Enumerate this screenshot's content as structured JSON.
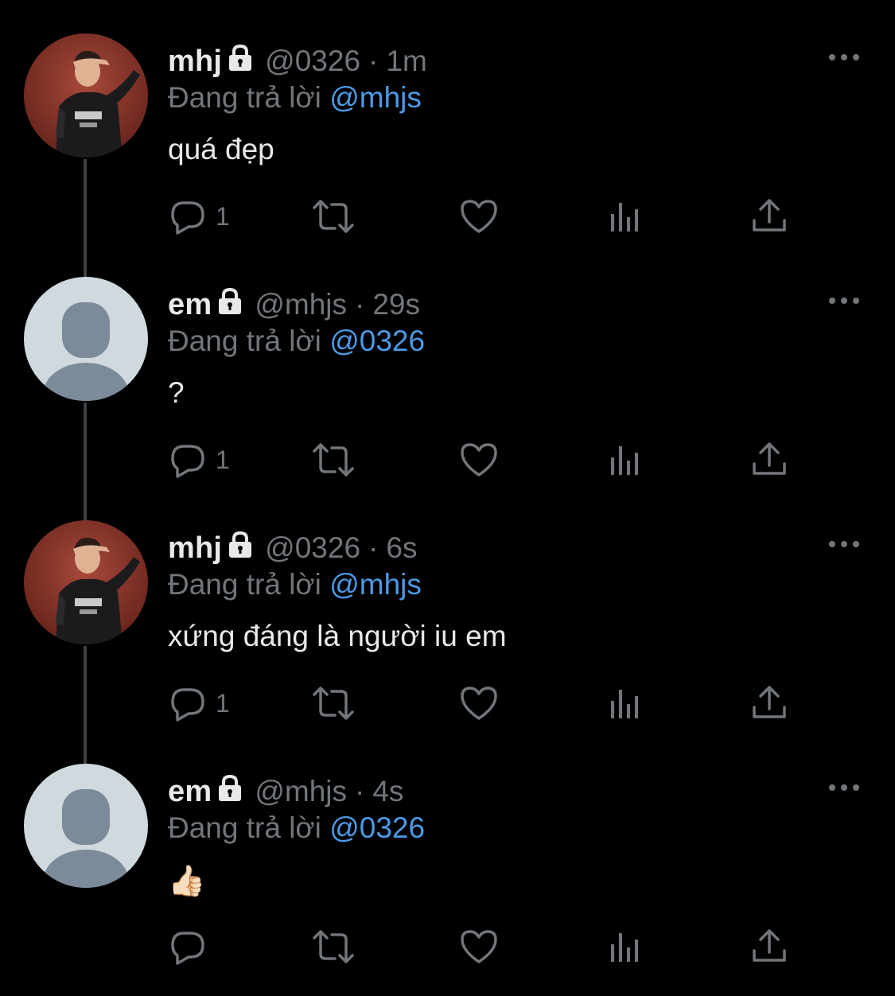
{
  "colors": {
    "background": "#000000",
    "name_text": "#e7e9ea",
    "secondary_text": "#71767b",
    "mention_link": "#4b9ae6",
    "thread_line": "#3e4144",
    "default_avatar_bg": "#cfd9de",
    "default_avatar_fg": "#7b8b99"
  },
  "tweets": [
    {
      "display_name": "mhj",
      "handle": "@0326",
      "separator": "·",
      "time": "1m",
      "reply_prefix": "Đang trả lời",
      "reply_to": "@mhjs",
      "text": "quá đẹp",
      "reply_count": "1",
      "avatar": "photo-avatar",
      "locked_icon": "lock-icon"
    },
    {
      "display_name": "em",
      "handle": "@mhjs",
      "separator": "·",
      "time": "29s",
      "reply_prefix": "Đang trả lời",
      "reply_to": "@0326",
      "text": "?",
      "reply_count": "1",
      "avatar": "default-avatar",
      "locked_icon": "lock-icon"
    },
    {
      "display_name": "mhj",
      "handle": "@0326",
      "separator": "·",
      "time": "6s",
      "reply_prefix": "Đang trả lời",
      "reply_to": "@mhjs",
      "text": "xứng đáng là người iu em",
      "reply_count": "1",
      "avatar": "photo-avatar",
      "locked_icon": "lock-icon"
    },
    {
      "display_name": "em",
      "handle": "@mhjs",
      "separator": "·",
      "time": "4s",
      "reply_prefix": "Đang trả lời",
      "reply_to": "@0326",
      "text": "👍🏻",
      "reply_count": "",
      "avatar": "default-avatar",
      "locked_icon": "lock-icon"
    }
  ],
  "action_icons": [
    "reply-icon",
    "retweet-icon",
    "like-icon",
    "views-icon",
    "share-icon"
  ],
  "more_icon": "more-options-icon"
}
